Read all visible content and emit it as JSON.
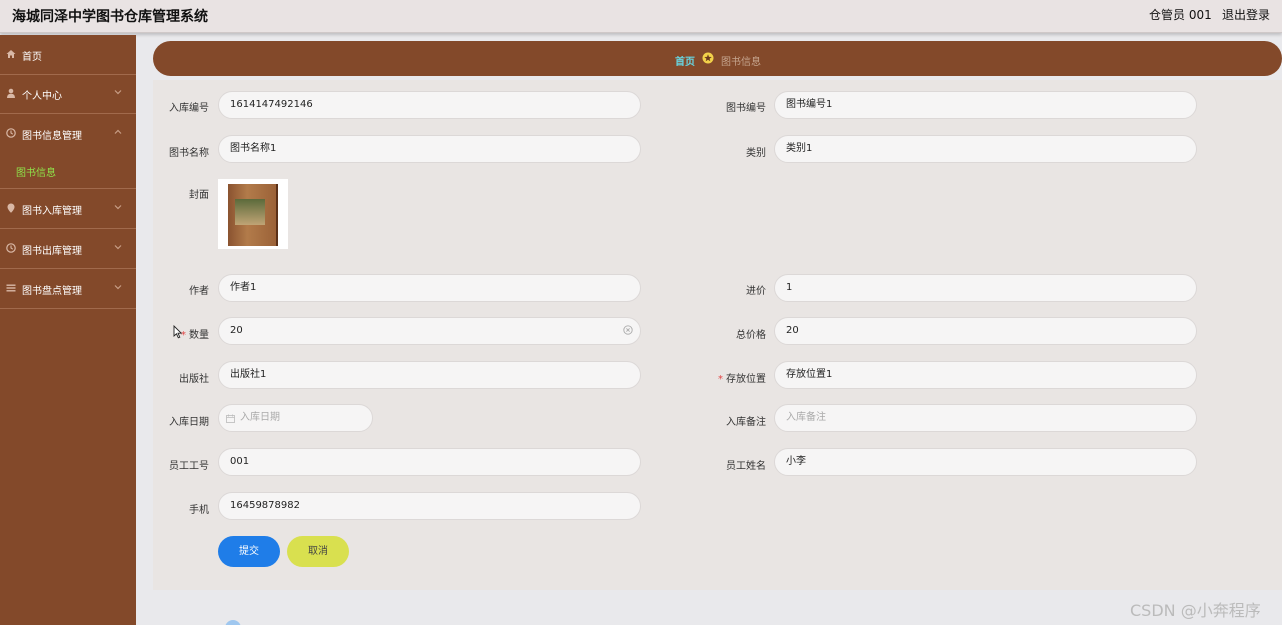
{
  "header": {
    "title": "海城同泽中学图书仓库管理系统",
    "user": "仓管员 001",
    "logout": "退出登录"
  },
  "sidebar": {
    "items": [
      {
        "label": "首页",
        "icon": "home-icon"
      },
      {
        "label": "个人中心",
        "icon": "user-icon"
      },
      {
        "label": "图书信息管理",
        "icon": "clock-icon",
        "expanded": true
      },
      {
        "label": "图书入库管理",
        "icon": "pin-icon"
      },
      {
        "label": "图书出库管理",
        "icon": "clock-icon"
      },
      {
        "label": "图书盘点管理",
        "icon": "list-icon"
      }
    ],
    "submenu": {
      "label": "图书信息",
      "color": "#8fe34a"
    }
  },
  "breadcrumb": {
    "home": "首页",
    "current": "图书信息"
  },
  "form": {
    "ruku_no": {
      "label": "入库编号",
      "value": "1614147492146"
    },
    "book_no": {
      "label": "图书编号",
      "value": "图书编号1"
    },
    "book_name": {
      "label": "图书名称",
      "value": "图书名称1"
    },
    "category": {
      "label": "类别",
      "value": "类别1"
    },
    "cover": {
      "label": "封面"
    },
    "author": {
      "label": "作者",
      "value": "作者1"
    },
    "price": {
      "label": "进价",
      "value": "1"
    },
    "quantity": {
      "label": "数量",
      "value": "20",
      "required": "*"
    },
    "total": {
      "label": "总价格",
      "value": "20"
    },
    "publisher": {
      "label": "出版社",
      "value": "出版社1"
    },
    "location": {
      "label": "存放位置",
      "value": "存放位置1",
      "required": "*"
    },
    "ruku_date": {
      "label": "入库日期",
      "placeholder": "入库日期"
    },
    "ruku_note": {
      "label": "入库备注",
      "placeholder": "入库备注"
    },
    "staff_no": {
      "label": "员工工号",
      "value": "001"
    },
    "staff_name": {
      "label": "员工姓名",
      "value": "小李"
    },
    "phone": {
      "label": "手机",
      "value": "16459878982"
    }
  },
  "buttons": {
    "submit": "提交",
    "cancel": "取消"
  },
  "watermark": "CSDN @小奔程序",
  "colors": {
    "sidebar": "#83492a",
    "accent_blue": "#1f7de8",
    "accent_yellow": "#d9e04f",
    "active_green": "#8fe34a"
  }
}
